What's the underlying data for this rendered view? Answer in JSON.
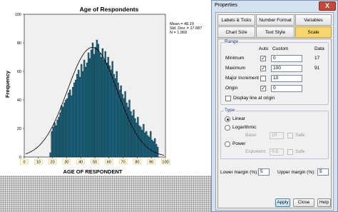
{
  "chart": {
    "stats": [
      "Mean = 48.19",
      "Std. Dev. = 17.687",
      "N = 1,969"
    ]
  },
  "chart_data": {
    "type": "bar",
    "title": "Age of Respondents",
    "xlabel": "AGE OF RESPONDENT",
    "ylabel": "Frequency",
    "xlim": [
      0,
      100
    ],
    "ylim": [
      0,
      100
    ],
    "x_ticks": [
      "0",
      "10",
      "20",
      "30",
      "40",
      "50",
      "60",
      "70",
      "80",
      "90",
      "100"
    ],
    "y_ticks": [
      "0",
      "20",
      "40",
      "60",
      "80",
      "100"
    ],
    "bin_start": 18,
    "bin_width": 1,
    "values": [
      3,
      18,
      21,
      24,
      22,
      26,
      28,
      31,
      36,
      35,
      38,
      40,
      41,
      45,
      47,
      43,
      49,
      52,
      54,
      58,
      61,
      56,
      65,
      60,
      68,
      63,
      66,
      73,
      69,
      75,
      80,
      72,
      77,
      82,
      79,
      73,
      70,
      76,
      68,
      74,
      66,
      70,
      64,
      61,
      67,
      58,
      55,
      60,
      52,
      47,
      50,
      44,
      41,
      46,
      38,
      35,
      40,
      32,
      29,
      33,
      27,
      24,
      28,
      22,
      21,
      19,
      23,
      17,
      18,
      15,
      14,
      18,
      12,
      11,
      13,
      9,
      7
    ],
    "normal_curve": {
      "mean": 48.19,
      "sd": 17.687
    },
    "bar_color": "#1f6f8b"
  },
  "properties": {
    "window_title": "Properties",
    "close_label": "X",
    "tabs_row1": [
      "Labels & Ticks",
      "Number Format",
      "Variables"
    ],
    "tabs_row2": [
      "Chart Size",
      "Text Style",
      "Scale"
    ],
    "range": {
      "title": "Range",
      "col_auto": "Auto",
      "col_custom": "Custom",
      "col_data": "Data",
      "rows": [
        {
          "label": "Minimum",
          "auto": true,
          "custom": "0",
          "data": "17"
        },
        {
          "label": "Maximum",
          "auto": true,
          "custom": "100",
          "data": "91"
        },
        {
          "label": "Major Increment",
          "auto": false,
          "custom": "10",
          "data": ""
        },
        {
          "label": "Origin",
          "auto": true,
          "custom": "0",
          "data": ""
        }
      ],
      "display_line_label": "Display line at origin"
    },
    "type": {
      "title": "Type",
      "linear": "Linear",
      "logarithmic": "Logarithmic",
      "base_label": "Base:",
      "base_value": "10",
      "safe_label": "Safe",
      "power": "Power",
      "exponent_label": "Exponent:",
      "exponent_value": "0.5"
    },
    "lower_margin_label": "Lower margin (%):",
    "lower_margin_value": "5",
    "upper_margin_label": "Upper margin (%):",
    "upper_margin_value": "5",
    "apply_label": "Apply",
    "cancel_label": "Close",
    "help_label": "Help"
  }
}
